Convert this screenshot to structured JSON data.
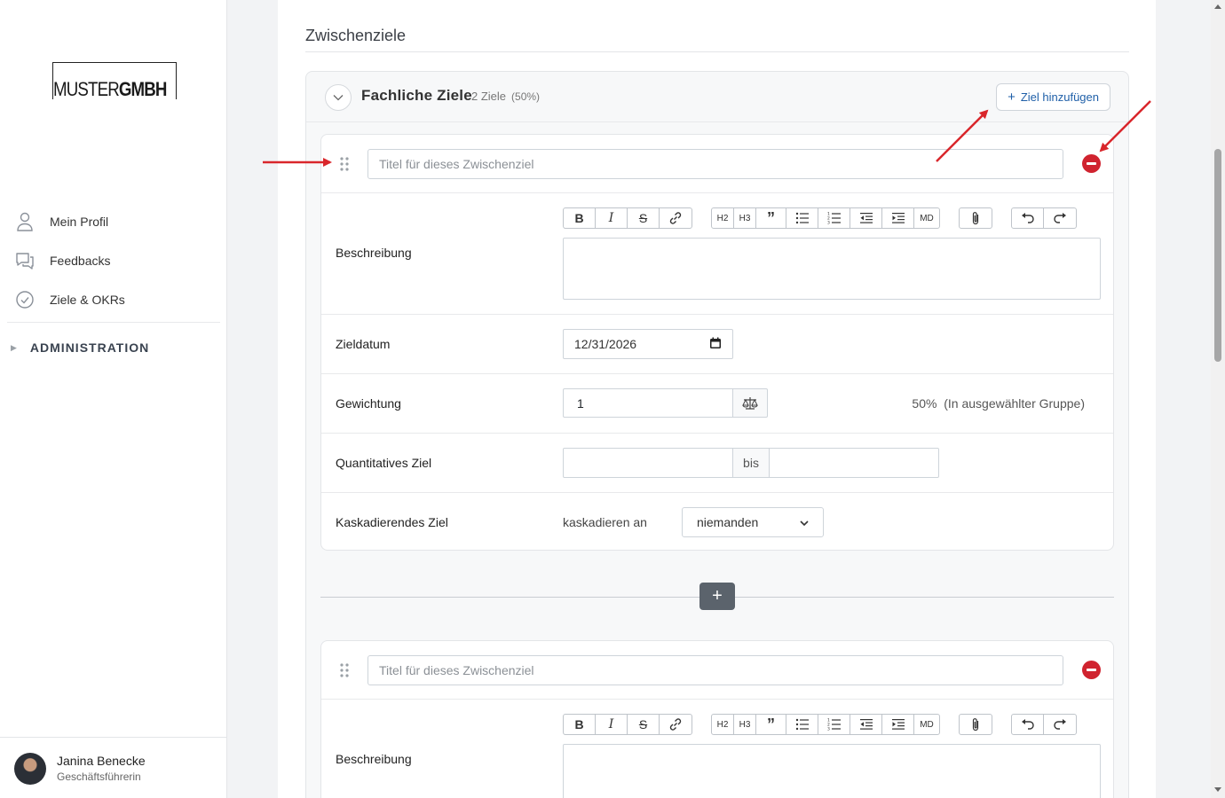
{
  "sidebar": {
    "logo_part1": "MUSTER",
    "logo_part2": "GMBH",
    "items": [
      {
        "label": "Mein Profil",
        "icon": "user-icon"
      },
      {
        "label": "Feedbacks",
        "icon": "chat-icon"
      },
      {
        "label": "Ziele & OKRs",
        "icon": "check-circle-icon"
      }
    ],
    "admin_label": "ADMINISTRATION",
    "user": {
      "name": "Janina Benecke",
      "role": "Geschäftsführerin"
    }
  },
  "main": {
    "section_title": "Zwischenziele",
    "group": {
      "title": "Fachliche Ziele",
      "count": "2 Ziele",
      "percent": "(50%)",
      "add_button": "Ziel hinzufügen"
    },
    "goals": [
      {
        "title_placeholder": "Titel für dieses Zwischenziel",
        "labels": {
          "description": "Beschreibung",
          "date": "Zieldatum",
          "weight": "Gewichtung",
          "quantitative": "Quantitatives Ziel",
          "cascading": "Kaskadierendes Ziel"
        },
        "date_value": "12/31/2026",
        "weight_value": "1",
        "weight_percent": "50%",
        "weight_info": "(In ausgewählter Gruppe)",
        "quant_separator": "bis",
        "cascade_text": "kaskadieren an",
        "cascade_select": "niemanden"
      },
      {
        "title_placeholder": "Titel für dieses Zwischenziel",
        "labels": {
          "description": "Beschreibung"
        }
      }
    ],
    "toolbar": {
      "h2": "H2",
      "h3": "H3",
      "md": "MD"
    }
  },
  "colors": {
    "accent": "#1f5fa8",
    "remove": "#d0232f",
    "annotation_arrow": "#d9262b"
  }
}
